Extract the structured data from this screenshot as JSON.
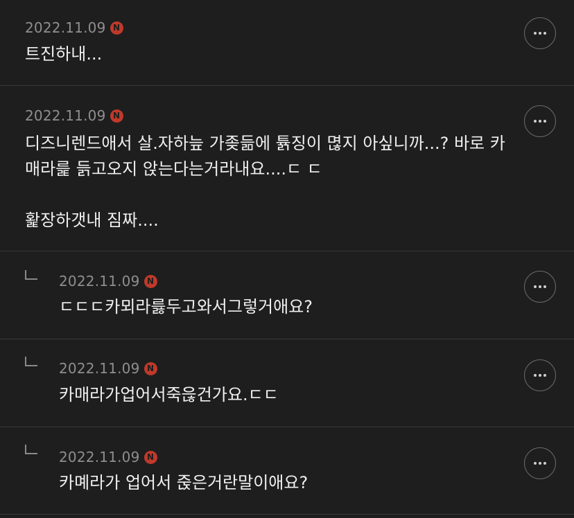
{
  "comments": [
    {
      "date": "2022.11.09",
      "badge": "N",
      "text": "트진하내...",
      "more_icon": "more-horizontal-icon"
    },
    {
      "date": "2022.11.09",
      "badge": "N",
      "text": "디즈니렌드애서 살.자하늪 가좆듦에 튥징이 멶지 아싶니까...? 바로 카매라릁 듥고오지 앉는다는거라내요....ㄷ ㄷ\n\n홡장하갯내 짐짜....",
      "more_icon": "more-horizontal-icon"
    },
    {
      "date": "2022.11.09",
      "badge": "N",
      "text": "ㄷㄷㄷ카뫼라릃두고와서그렇거애요?",
      "reply": true,
      "more_icon": "more-horizontal-icon"
    },
    {
      "date": "2022.11.09",
      "badge": "N",
      "text": "카매라가업어서죽읂건가요.ㄷㄷ",
      "reply": true,
      "more_icon": "more-horizontal-icon"
    },
    {
      "date": "2022.11.09",
      "badge": "N",
      "text": "카몌라가 업어서 줁은거란말이애요?",
      "reply": true,
      "more_icon": "more-horizontal-icon"
    }
  ],
  "colors": {
    "background": "#1e1e1e",
    "divider": "#383838",
    "date": "#8f8f8f",
    "badge": "#c0392b",
    "text": "#f0f0f0"
  }
}
